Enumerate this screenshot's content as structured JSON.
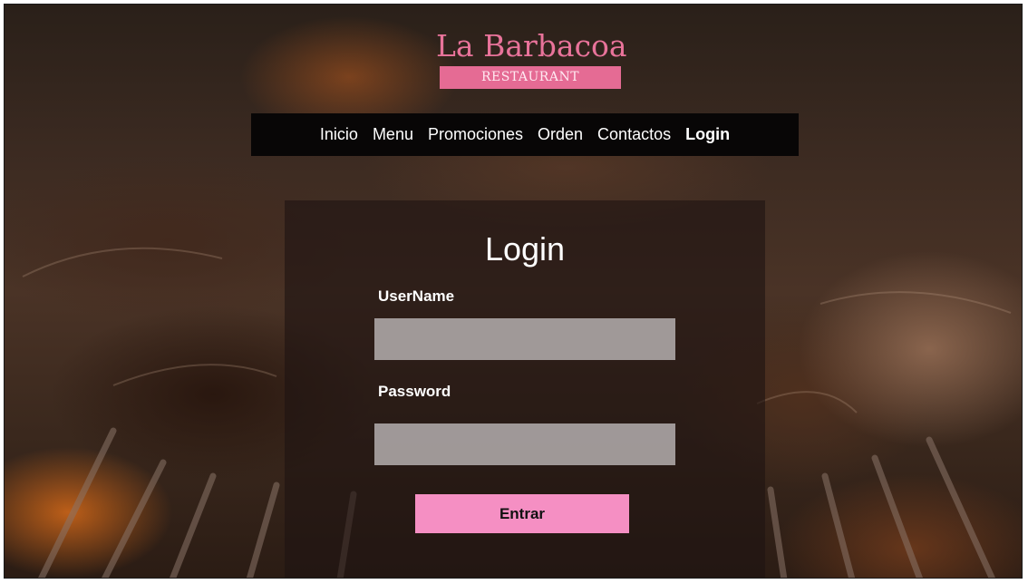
{
  "brand": {
    "name": "La Barbacoa",
    "tagline": "RESTAURANT"
  },
  "nav": {
    "items": [
      {
        "label": "Inicio",
        "active": false
      },
      {
        "label": "Menu",
        "active": false
      },
      {
        "label": "Promociones",
        "active": false
      },
      {
        "label": "Orden",
        "active": false
      },
      {
        "label": "Contactos",
        "active": false
      },
      {
        "label": "Login",
        "active": true
      }
    ]
  },
  "login": {
    "title": "Login",
    "username_label": "UserName",
    "username_value": "",
    "password_label": "Password",
    "password_value": "",
    "submit_label": "Entrar"
  },
  "colors": {
    "brand_pink": "#e8739a",
    "tagline_bg": "#e56b94",
    "button_bg": "#f58fc3",
    "nav_bg": "#080606"
  }
}
